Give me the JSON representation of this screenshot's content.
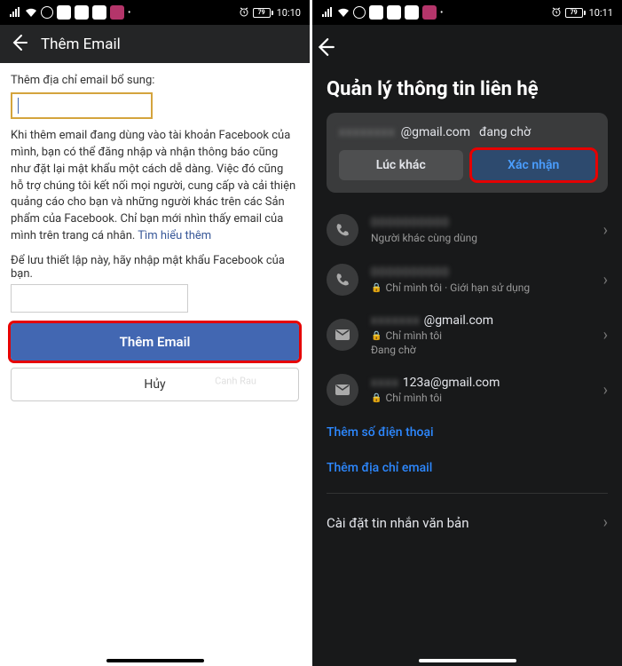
{
  "left": {
    "statusbar": {
      "time": "10:10",
      "battery": "79"
    },
    "header_title": "Thêm Email",
    "label_add_email": "Thêm địa chỉ email bổ sung:",
    "info_text": "Khi thêm email đang dùng vào tài khoản Facebook của mình, bạn có thể đăng nhập và nhận thông báo cũng như đặt lại mật khẩu một cách dễ dàng. Việc đó cũng hỗ trợ chúng tôi kết nối mọi người, cung cấp và cải thiện quảng cáo cho bạn và những người khác trên các Sản phẩm của Facebook. Chỉ bạn mới nhìn thấy email của mình trên trang cá nhân. ",
    "learn_more": "Tìm hiểu thêm",
    "pwd_label": "Để lưu thiết lập này, hãy nhập mật khẩu Facebook của bạn.",
    "btn_add": "Thêm Email",
    "btn_cancel": "Hủy",
    "watermark": "Canh Rau"
  },
  "right": {
    "statusbar": {
      "time": "10:11",
      "battery": "79"
    },
    "page_title": "Quản lý thông tin liên hệ",
    "pending": {
      "email_suffix": "@gmail.com",
      "status": "đang chờ",
      "btn_later": "Lúc khác",
      "btn_confirm": "Xác nhận"
    },
    "contacts": [
      {
        "type": "phone",
        "sub": "Người khác cùng dùng",
        "main_blur": true
      },
      {
        "type": "phone",
        "sub": "Chỉ mình tôi · Giới hạn sử dụng",
        "locked": true,
        "main_blur": true
      },
      {
        "type": "email",
        "main": "@gmail.com",
        "sub": "Chỉ mình tôi",
        "sub2": "Đang chờ",
        "locked": true,
        "main_blur_prefix": true
      },
      {
        "type": "email",
        "main": "123a@gmail.com",
        "sub": "Chỉ mình tôi",
        "locked": true,
        "main_blur_prefix": true
      }
    ],
    "link_phone": "Thêm số điện thoại",
    "link_email": "Thêm địa chỉ email",
    "sms_settings": "Cài đặt tin nhắn văn bản"
  }
}
